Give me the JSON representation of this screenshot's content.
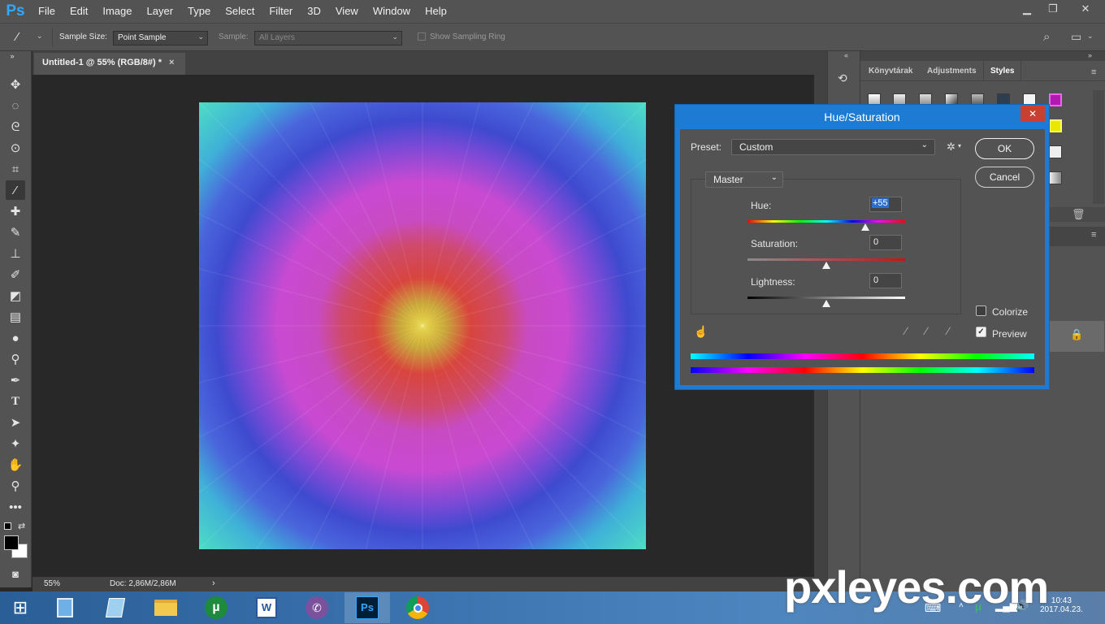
{
  "app": {
    "logo": "Ps",
    "menu": [
      "File",
      "Edit",
      "Image",
      "Layer",
      "Type",
      "Select",
      "Filter",
      "3D",
      "View",
      "Window",
      "Help"
    ],
    "window_controls": [
      "minimize",
      "restore",
      "close"
    ]
  },
  "options": {
    "sample_size_label": "Sample Size:",
    "sample_size_value": "Point Sample",
    "sample_label": "Sample:",
    "sample_value": "All Layers",
    "sampling_ring_label": "Show Sampling Ring"
  },
  "document": {
    "tab_title": "Untitled-1 @ 55% (RGB/8#) *",
    "close": "×",
    "zoom": "55%",
    "doc_info": "Doc: 2,86M/2,86M"
  },
  "panels": {
    "tabs": [
      "Könyvtárak",
      "Adjustments",
      "Styles"
    ],
    "active_tab": "Styles"
  },
  "dialog": {
    "title": "Hue/Saturation",
    "close": "✕",
    "preset_label": "Preset:",
    "preset_value": "Custom",
    "channel": "Master",
    "hue_label": "Hue:",
    "hue_value": "+55",
    "hue_level": 55,
    "saturation_label": "Saturation:",
    "saturation_value": "0",
    "lightness_label": "Lightness:",
    "lightness_value": "0",
    "ok": "OK",
    "cancel": "Cancel",
    "colorize_label": "Colorize",
    "colorize_checked": false,
    "preview_label": "Preview",
    "preview_checked": true
  },
  "taskbar": {
    "apps": [
      "calculator",
      "notepad",
      "file-explorer",
      "utorrent",
      "word",
      "viber",
      "photoshop",
      "chrome"
    ],
    "active": "photoshop"
  },
  "watermark": "pxleyes.com",
  "clock": {
    "time": "10:43",
    "date": "2017.04.23."
  }
}
